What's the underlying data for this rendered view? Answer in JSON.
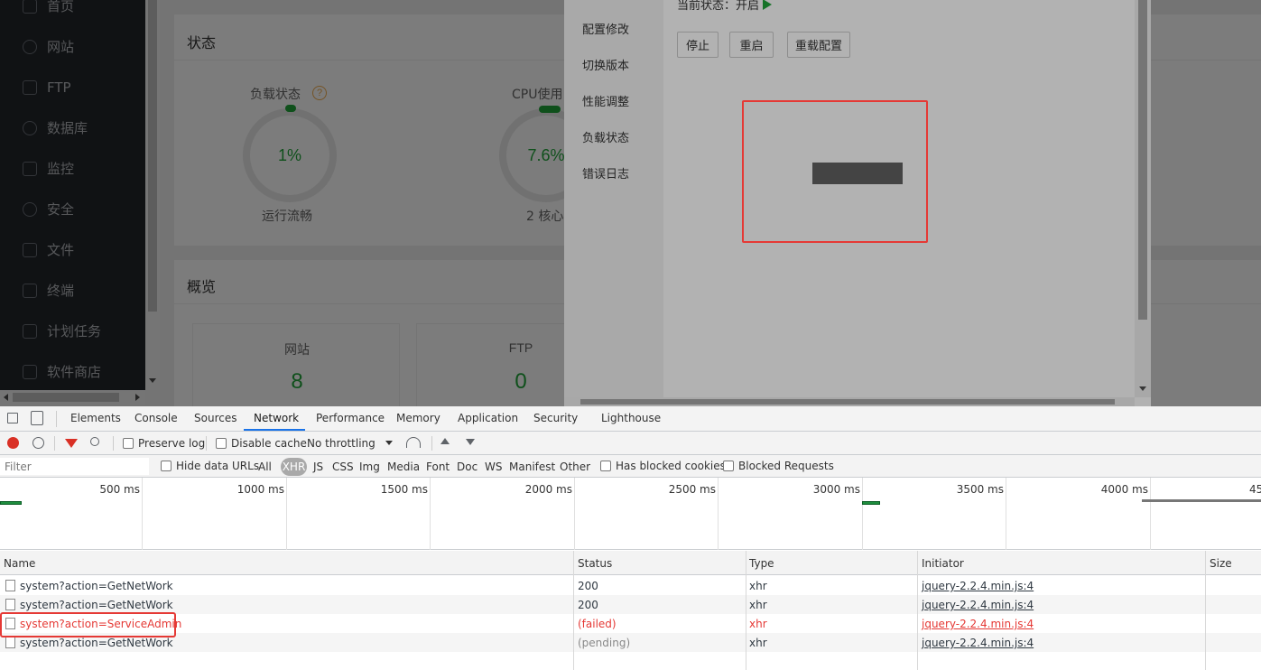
{
  "sidebar": {
    "items": [
      {
        "label": "首页",
        "icon": "home-icon"
      },
      {
        "label": "网站",
        "icon": "globe-icon"
      },
      {
        "label": "FTP",
        "icon": "ftp-icon"
      },
      {
        "label": "数据库",
        "icon": "database-icon"
      },
      {
        "label": "监控",
        "icon": "monitor-icon"
      },
      {
        "label": "安全",
        "icon": "shield-icon"
      },
      {
        "label": "文件",
        "icon": "folder-icon"
      },
      {
        "label": "终端",
        "icon": "terminal-icon"
      },
      {
        "label": "计划任务",
        "icon": "calendar-icon"
      },
      {
        "label": "软件商店",
        "icon": "apps-icon"
      }
    ]
  },
  "status_panel": {
    "title": "状态",
    "load_label": "负载状态",
    "load_value": "1%",
    "load_percent": 1,
    "load_caption": "运行流畅",
    "cpu_label": "CPU使用",
    "cpu_value": "7.6%",
    "cpu_percent": 7.6,
    "cpu_caption": "2 核心"
  },
  "overview_panel": {
    "title": "概览",
    "site_label": "网站",
    "site_count": "8",
    "ftp_label": "FTP",
    "ftp_count": "0"
  },
  "modal": {
    "status_text": "当前状态：开启",
    "menu": [
      "配置修改",
      "切换版本",
      "性能调整",
      "负载状态",
      "错误日志"
    ],
    "buttons": {
      "stop": "停止",
      "restart": "重启",
      "reload": "重载配置"
    }
  },
  "devtools": {
    "tabs": [
      "Elements",
      "Console",
      "Sources",
      "Network",
      "Performance",
      "Memory",
      "Application",
      "Security",
      "Lighthouse"
    ],
    "active_tab": "Network",
    "toolbar": {
      "preserve_log": "Preserve log",
      "disable_cache": "Disable cache",
      "throttling": "No throttling"
    },
    "filter": {
      "placeholder": "Filter",
      "hide_data_urls": "Hide data URLs",
      "types": [
        "All",
        "XHR",
        "JS",
        "CSS",
        "Img",
        "Media",
        "Font",
        "Doc",
        "WS",
        "Manifest",
        "Other"
      ],
      "active_type": "XHR",
      "has_blocked_cookies": "Has blocked cookies",
      "blocked_requests": "Blocked Requests"
    },
    "timeline_ticks": [
      "500 ms",
      "1000 ms",
      "1500 ms",
      "2000 ms",
      "2500 ms",
      "3000 ms",
      "3500 ms",
      "4000 ms",
      "45"
    ],
    "columns": [
      "Name",
      "Status",
      "Type",
      "Initiator",
      "Size"
    ],
    "rows": [
      {
        "name": "system?action=GetNetWork",
        "status": "200",
        "type": "xhr",
        "initiator": "jquery-2.2.4.min.js:4"
      },
      {
        "name": "system?action=GetNetWork",
        "status": "200",
        "type": "xhr",
        "initiator": "jquery-2.2.4.min.js:4"
      },
      {
        "name": "system?action=ServiceAdmin",
        "status": "(failed)",
        "type": "xhr",
        "initiator": "jquery-2.2.4.min.js:4"
      },
      {
        "name": "system?action=GetNetWork",
        "status": "(pending)",
        "type": "xhr",
        "initiator": "jquery-2.2.4.min.js:4"
      }
    ]
  },
  "colors": {
    "accent": "#20a53a",
    "error": "#e53935",
    "devtools_blue": "#1a73e8"
  }
}
